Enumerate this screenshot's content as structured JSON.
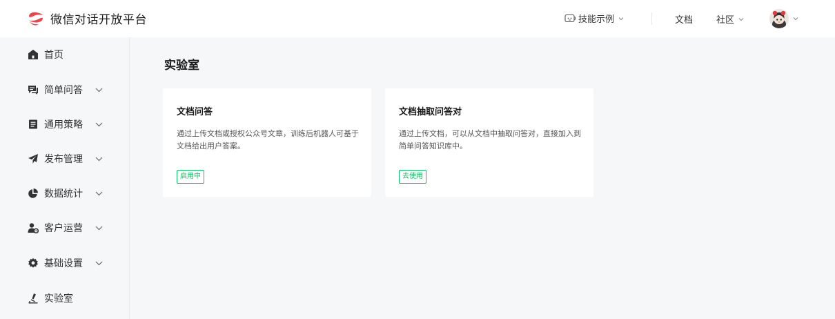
{
  "header": {
    "brand_name": "微信对话开放平台",
    "nav": {
      "skills": "技能示例",
      "docs": "文档",
      "community": "社区"
    }
  },
  "sidebar": {
    "items": [
      {
        "label": "首页",
        "icon": "home-icon"
      },
      {
        "label": "简单问答",
        "icon": "chat-icon"
      },
      {
        "label": "通用策略",
        "icon": "document-icon"
      },
      {
        "label": "发布管理",
        "icon": "paper-plane-icon"
      },
      {
        "label": "数据统计",
        "icon": "pie-chart-icon"
      },
      {
        "label": "客户运营",
        "icon": "user-settings-icon"
      },
      {
        "label": "基础设置",
        "icon": "gear-icon"
      },
      {
        "label": "实验室",
        "icon": "flask-icon"
      }
    ]
  },
  "main": {
    "title": "实验室",
    "cards": [
      {
        "title": "文档问答",
        "desc": "通过上传文档或授权公众号文章，训练后机器人可基于文档给出用户答案。",
        "tag": "启用中"
      },
      {
        "title": "文档抽取问答对",
        "desc": "通过上传文档，可以从文档中抽取问答对，直接加入到简单问答知识库中。",
        "tag": "去使用"
      }
    ]
  },
  "colors": {
    "accent_green": "#07c160",
    "logo_red": "#f2414a"
  }
}
